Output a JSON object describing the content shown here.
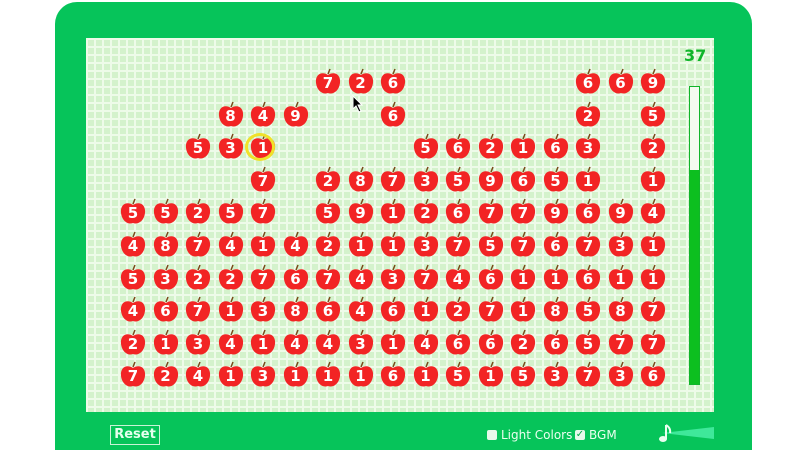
{
  "score": "37",
  "timer_remaining_percent": 72,
  "selected": {
    "row": 2,
    "col": 4
  },
  "grid": [
    [
      null,
      null,
      null,
      null,
      null,
      null,
      7,
      2,
      6,
      null,
      null,
      null,
      null,
      null,
      6,
      6,
      9
    ],
    [
      null,
      null,
      null,
      8,
      4,
      9,
      null,
      null,
      6,
      null,
      null,
      null,
      null,
      null,
      2,
      null,
      5
    ],
    [
      null,
      null,
      5,
      3,
      1,
      null,
      null,
      null,
      null,
      5,
      6,
      2,
      1,
      6,
      3,
      null,
      2
    ],
    [
      null,
      null,
      null,
      null,
      7,
      null,
      2,
      8,
      7,
      3,
      5,
      9,
      6,
      5,
      1,
      null,
      1
    ],
    [
      5,
      5,
      2,
      5,
      7,
      null,
      5,
      9,
      1,
      2,
      6,
      7,
      7,
      9,
      6,
      9,
      4
    ],
    [
      4,
      8,
      7,
      4,
      1,
      4,
      2,
      1,
      1,
      3,
      7,
      5,
      7,
      6,
      7,
      3,
      1
    ],
    [
      5,
      3,
      2,
      2,
      7,
      6,
      7,
      4,
      3,
      7,
      4,
      6,
      1,
      1,
      6,
      1,
      1
    ],
    [
      4,
      6,
      7,
      1,
      3,
      8,
      6,
      4,
      6,
      1,
      2,
      7,
      1,
      8,
      5,
      8,
      7
    ],
    [
      2,
      1,
      3,
      4,
      1,
      4,
      4,
      3,
      1,
      4,
      6,
      6,
      2,
      6,
      5,
      7,
      7
    ],
    [
      7,
      2,
      4,
      1,
      3,
      1,
      1,
      1,
      6,
      1,
      5,
      1,
      5,
      3,
      7,
      3,
      6
    ]
  ],
  "controls": {
    "reset_label": "Reset",
    "light_colors_label": "Light Colors",
    "light_colors_checked": false,
    "bgm_label": "BGM",
    "bgm_checked": true
  },
  "colors": {
    "frame": "#06c45a",
    "apple": "#f22424",
    "accent": "#10b52a"
  }
}
